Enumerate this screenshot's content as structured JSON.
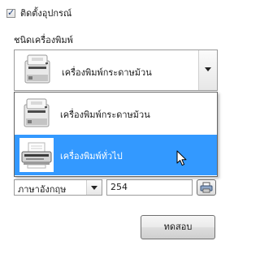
{
  "install_device": {
    "checked": true,
    "label": "ติดตั้งอุปกรณ์"
  },
  "printer_type": {
    "label": "ชนิดเครื่องพิมพ์",
    "selected": "เครื่องพิมพ์กระดาษม้วน",
    "selected_icon": "receipt-printer-icon",
    "options": [
      {
        "label": "เครื่องพิมพ์กระดาษม้วน",
        "icon": "receipt-printer-icon",
        "highlighted": false
      },
      {
        "label": "เครื่องพิมพ์ทั่วไป",
        "icon": "dot-matrix-printer-icon",
        "highlighted": true
      }
    ]
  },
  "language": {
    "selected": "ภาษาอังกฤษ"
  },
  "number_field": {
    "value": "254"
  },
  "test_button": {
    "label": "ทดสอบ"
  },
  "colors": {
    "highlight": "#3399ff",
    "highlight_text": "#ffffff",
    "border": "#9b9b9b"
  }
}
